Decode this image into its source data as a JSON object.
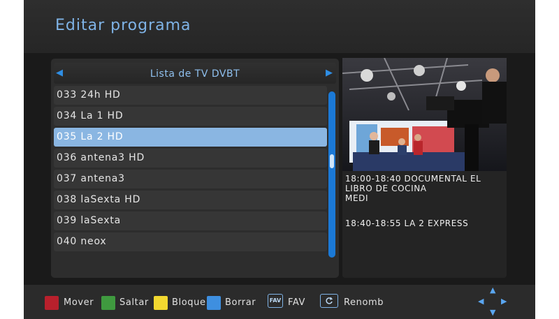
{
  "header": {
    "title": "Editar programa"
  },
  "list": {
    "title": "Lista de TV DVBT",
    "prev_icon": "triangle-left-icon",
    "next_icon": "triangle-right-icon",
    "channels": [
      "033 24h HD",
      "034 La 1 HD",
      "035 La 2 HD",
      "036 antena3 HD",
      "037 antena3",
      "038 laSexta HD",
      "039 laSexta",
      "040 neox"
    ],
    "selected_index": 2
  },
  "epg": {
    "items": [
      {
        "line1": "18:00-18:40  DOCUMENTAL EL",
        "line2": "LIBRO DE COCINA",
        "line3": "MEDI"
      },
      {
        "line1": "18:40-18:55  LA 2 EXPRESS",
        "line2": "",
        "line3": ""
      }
    ]
  },
  "footer": {
    "mover": {
      "label": "Mover",
      "color": "#b8202c"
    },
    "saltar": {
      "label": "Saltar",
      "color": "#3f9a3f"
    },
    "bloque": {
      "label": "Bloque",
      "color": "#f2d830"
    },
    "borrar": {
      "label": "Borrar",
      "color": "#3e8fe0"
    },
    "fav": {
      "icon_text": "FAV",
      "label": "FAV"
    },
    "renomb": {
      "icon": "rename-icon",
      "label": "Renomb"
    },
    "nav_icon": "navigation-arrows-icon"
  },
  "colors": {
    "accent": "#7fb3e6",
    "selected_row": "#8ab6e2",
    "scrollbar": "#1b79d6"
  }
}
